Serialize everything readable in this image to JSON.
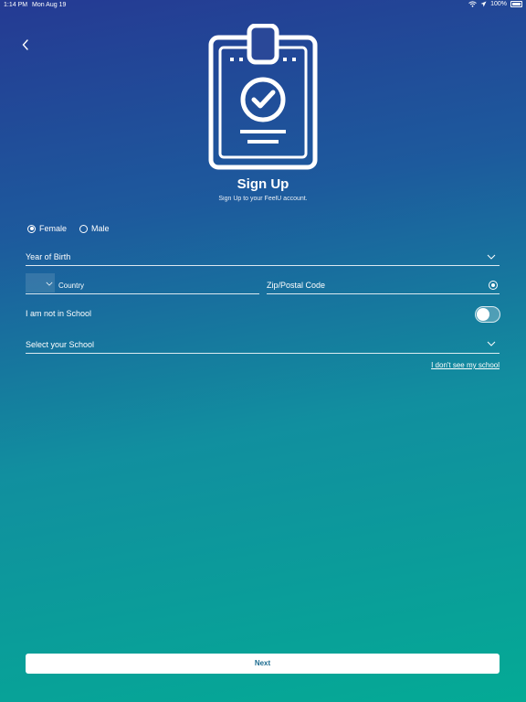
{
  "status_bar": {
    "time": "1:14 PM",
    "date": "Mon Aug 19",
    "battery": "100%"
  },
  "header": {
    "title": "Sign Up",
    "subtitle": "Sign Up to your FeelU account."
  },
  "gender": {
    "options": [
      {
        "label": "Female",
        "selected": true
      },
      {
        "label": "Male",
        "selected": false
      }
    ]
  },
  "form": {
    "year_of_birth": "Year of Birth",
    "country": "Country",
    "zip": "Zip/Postal Code",
    "not_in_school_label": "I am not in School",
    "not_in_school_on": false,
    "school": "Select your School",
    "no_school_link": "I don't see my school"
  },
  "footer": {
    "next_label": "Next"
  },
  "colors": {
    "gradient_top": "#253a93",
    "gradient_bottom": "#04aa95",
    "button_text": "#1c6b8f"
  },
  "icons": [
    "back-icon",
    "clipboard-check-icon",
    "chevron-down-icon",
    "location-icon",
    "wifi-icon",
    "location-arrow-icon",
    "battery-icon"
  ]
}
